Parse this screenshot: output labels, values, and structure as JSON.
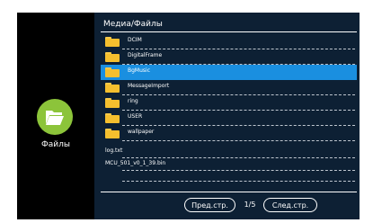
{
  "side": {
    "label": "Файлы",
    "icon": "folder-open-icon"
  },
  "header": {
    "title": "Медиа/Файлы"
  },
  "folders": [
    {
      "name": "DCIM",
      "selected": false
    },
    {
      "name": "DigitalFrame",
      "selected": false
    },
    {
      "name": "BgMusic",
      "selected": true
    },
    {
      "name": "MessageImport",
      "selected": false
    },
    {
      "name": "ring",
      "selected": false
    },
    {
      "name": "USER",
      "selected": false
    },
    {
      "name": "wallpaper",
      "selected": false
    }
  ],
  "files": [
    {
      "name": "log.txt"
    },
    {
      "name": "MCU_501_v0_1_39.bin"
    }
  ],
  "pager": {
    "prev_label": "Пред.стр.",
    "page_indicator": "1/5",
    "next_label": "След.стр."
  },
  "colors": {
    "panel_bg": "#0d2034",
    "selected_row": "#1a8fe0",
    "folder": "#f5bf2e",
    "side_icon_bg": "#8cc43a"
  }
}
